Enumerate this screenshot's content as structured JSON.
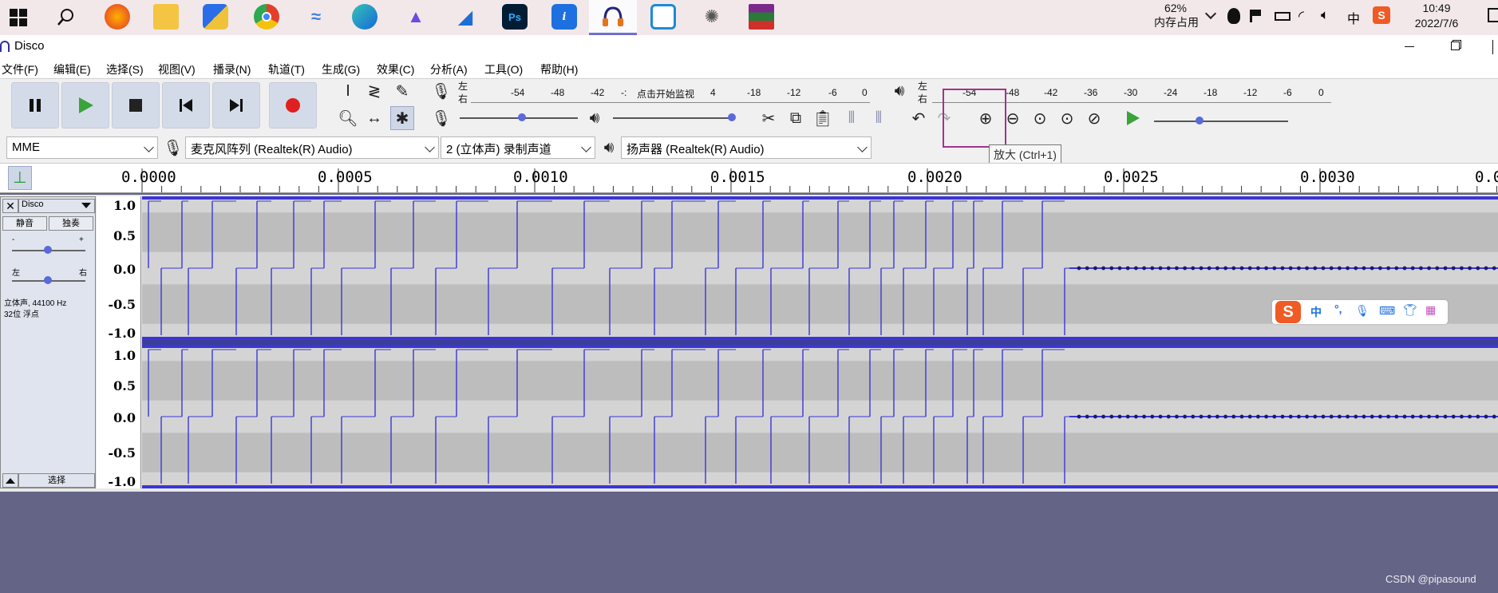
{
  "taskbar": {
    "memory_percent": "62%",
    "memory_label": "内存占用",
    "time": "10:49",
    "date": "2022/7/6",
    "ps_label": "Ps"
  },
  "window": {
    "title": "Disco"
  },
  "menu": [
    "文件(F)",
    "编辑(E)",
    "选择(S)",
    "视图(V)",
    "播录(N)",
    "轨道(T)",
    "生成(G)",
    "效果(C)",
    "分析(A)",
    "工具(O)",
    "帮助(H)"
  ],
  "meters": {
    "left_label": "左",
    "right_label": "右",
    "record_ticks": [
      "-54",
      "-48",
      "-42",
      "-:",
      "4",
      "-18",
      "-12",
      "-6",
      "0"
    ],
    "record_hint": "点击开始监视",
    "play_ticks": [
      "-54",
      "-48",
      "-42",
      "-36",
      "-30",
      "-24",
      "-18",
      "-12",
      "-6",
      "0"
    ]
  },
  "device": {
    "host": "MME",
    "input": "麦克风阵列 (Realtek(R) Audio)",
    "channels": "2 (立体声) 录制声道",
    "output": "扬声器 (Realtek(R) Audio)"
  },
  "tooltip": "放大 (Ctrl+1)",
  "ruler": {
    "labels": [
      "0.0000",
      "0.0005",
      "0.0010",
      "0.0015",
      "0.0020",
      "0.0025",
      "0.0030",
      "0.0"
    ]
  },
  "track": {
    "name": "Disco",
    "mute": "静音",
    "solo": "独奏",
    "gain_minus": "-",
    "gain_plus": "+",
    "pan_left": "左",
    "pan_right": "右",
    "info_line1": "立体声, 44100 Hz",
    "info_line2": "32位 浮点",
    "select": "选择",
    "scale": [
      "1.0",
      "0.5",
      "0.0",
      "-0.5",
      "-1.0"
    ]
  },
  "ime": {
    "chinese": "中"
  },
  "watermark": "CSDN @pipasound",
  "colors": {
    "waveform": "#3a36d6",
    "taskbar_bg": "#f2e8ea",
    "workspace": "#646487",
    "record_red": "#e02020",
    "play_green": "#3aa33a"
  }
}
